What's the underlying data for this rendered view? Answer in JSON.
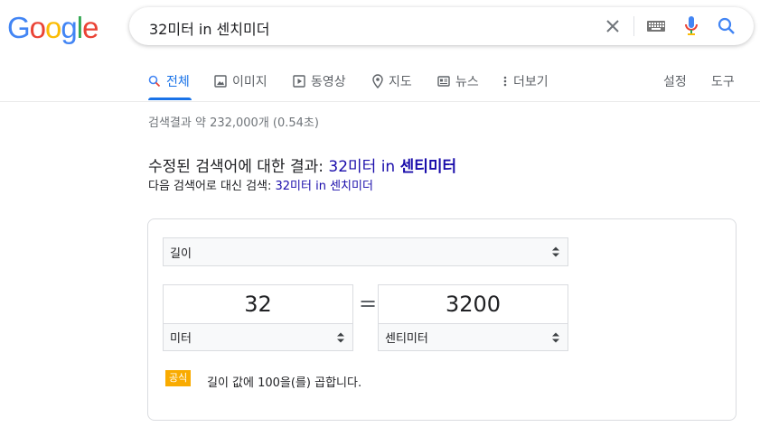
{
  "logo": {
    "letters": [
      "G",
      "o",
      "o",
      "g",
      "l",
      "e"
    ],
    "colors": [
      "#4285F4",
      "#EA4335",
      "#FBBC05",
      "#4285F4",
      "#34A853",
      "#EA4335"
    ]
  },
  "search": {
    "query": "32미터 in 센치미더"
  },
  "tabs": [
    {
      "label": "전체",
      "icon": "search-icon",
      "active": true
    },
    {
      "label": "이미지",
      "icon": "image-icon"
    },
    {
      "label": "동영상",
      "icon": "play-icon"
    },
    {
      "label": "지도",
      "icon": "map-pin-icon"
    },
    {
      "label": "뉴스",
      "icon": "news-icon"
    },
    {
      "label": "더보기",
      "icon": "more-vert-icon"
    }
  ],
  "tools": {
    "settings": "설정",
    "tools": "도구"
  },
  "result_stats": "검색결과 약 232,000개 (0.54초)",
  "correction": {
    "prefix": "수정된 검색어에 대한 결과: ",
    "link_plain": "32미터 in ",
    "link_bold": "센티미터",
    "instead_prefix": "다음 검색어로 대신 검색: ",
    "instead_link": "32미터 in 센치미더"
  },
  "converter": {
    "category": "길이",
    "from_value": "32",
    "from_unit": "미터",
    "equals": "=",
    "to_value": "3200",
    "to_unit": "센티미터",
    "formula_badge": "공식",
    "formula": "길이 값에 100을(를) 곱합니다."
  },
  "colors": {
    "accent": "#1a73e8",
    "link": "#1a0dab",
    "badge": "#f9ab00"
  }
}
